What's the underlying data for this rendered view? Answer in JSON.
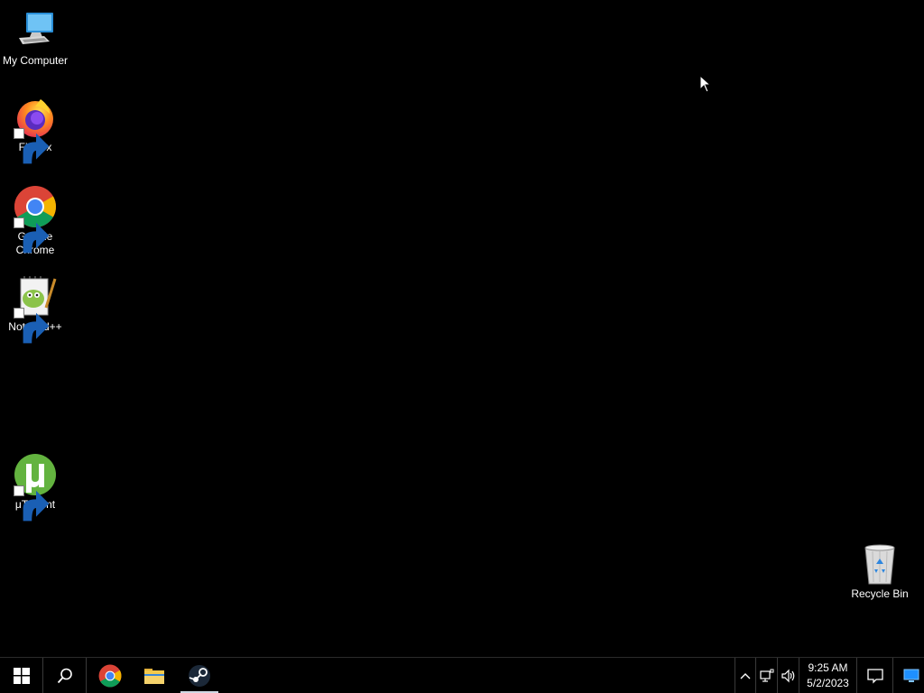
{
  "desktop": {
    "background_color": "#000000",
    "icons": [
      {
        "label": "My Computer",
        "icon": "computer-icon",
        "shortcut": false
      },
      {
        "label": "Firefox",
        "icon": "firefox-icon",
        "shortcut": true
      },
      {
        "label": "Google Chrome",
        "icon": "chrome-icon",
        "shortcut": true
      },
      {
        "label": "Notepad++",
        "icon": "notepadpp-icon",
        "shortcut": true
      },
      {
        "label": "μTorrent",
        "icon": "utorrent-icon",
        "shortcut": true
      },
      {
        "label": "Recycle Bin",
        "icon": "recycle-bin-icon",
        "shortcut": false
      }
    ]
  },
  "taskbar": {
    "start": {
      "icon": "windows-logo-icon"
    },
    "search": {
      "icon": "search-icon"
    },
    "pinned": [
      {
        "app": "Google Chrome",
        "icon": "chrome-icon",
        "active": false
      },
      {
        "app": "File Explorer",
        "icon": "folder-icon",
        "active": false
      },
      {
        "app": "Steam",
        "icon": "steam-icon",
        "active": true
      }
    ],
    "tray": {
      "icons": [
        "chevron-up-icon",
        "network-icon",
        "volume-icon"
      ],
      "time": "9:25 AM",
      "date": "5/2/2023",
      "notification_icon": "action-center-icon",
      "show_desktop_icon": "show-desktop-icon"
    }
  },
  "colors": {
    "taskbar": "#000000",
    "accent_blue": "#1e90ff",
    "chrome_red": "#db4437",
    "chrome_yellow": "#f4b400",
    "chrome_green": "#0f9d58",
    "chrome_blue": "#4285f4"
  }
}
